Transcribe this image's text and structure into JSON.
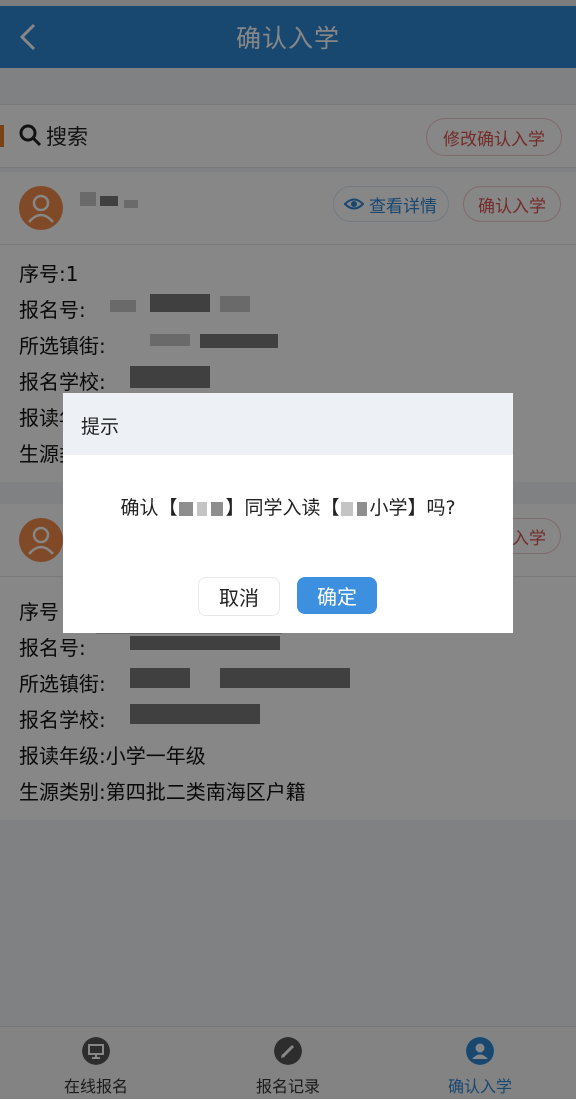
{
  "header": {
    "title": "确认入学"
  },
  "search": {
    "label": "搜索",
    "modify_button": "修改确认入学"
  },
  "records": [
    {
      "detail_button": "查看详情",
      "confirm_button": "确认入学",
      "fields": [
        {
          "label": "序号:",
          "value": "1"
        },
        {
          "label": "报名号:",
          "value": ""
        },
        {
          "label": "所选镇街:",
          "value": ""
        },
        {
          "label": "报名学校:",
          "value": ""
        },
        {
          "label": "报读年级:",
          "value": ""
        },
        {
          "label": "生源类别:",
          "value": ""
        }
      ]
    },
    {
      "confirm_button": "确认入学",
      "fields": [
        {
          "label": "序号",
          "value": ""
        },
        {
          "label": "报名号:",
          "value": ""
        },
        {
          "label": "所选镇街:",
          "value": ""
        },
        {
          "label": "报名学校:",
          "value": ""
        },
        {
          "label": "报读年级:",
          "value": "小学一年级"
        },
        {
          "label": "生源类别:",
          "value": "第四批二类南海区户籍"
        }
      ]
    }
  ],
  "dialog": {
    "title": "提示",
    "message_part1": "确认【",
    "message_part2": "】同学入读【",
    "message_part3": "小学】吗?",
    "cancel": "取消",
    "ok": "确定"
  },
  "tabs": [
    {
      "label": "在线报名",
      "icon": "monitor-icon"
    },
    {
      "label": "报名记录",
      "icon": "pencil-icon"
    },
    {
      "label": "确认入学",
      "icon": "user-icon"
    }
  ],
  "colors": {
    "brand": "#2f86d4",
    "accent": "#e67e22",
    "danger": "#d9534f",
    "avatar": "#f28a4b"
  }
}
